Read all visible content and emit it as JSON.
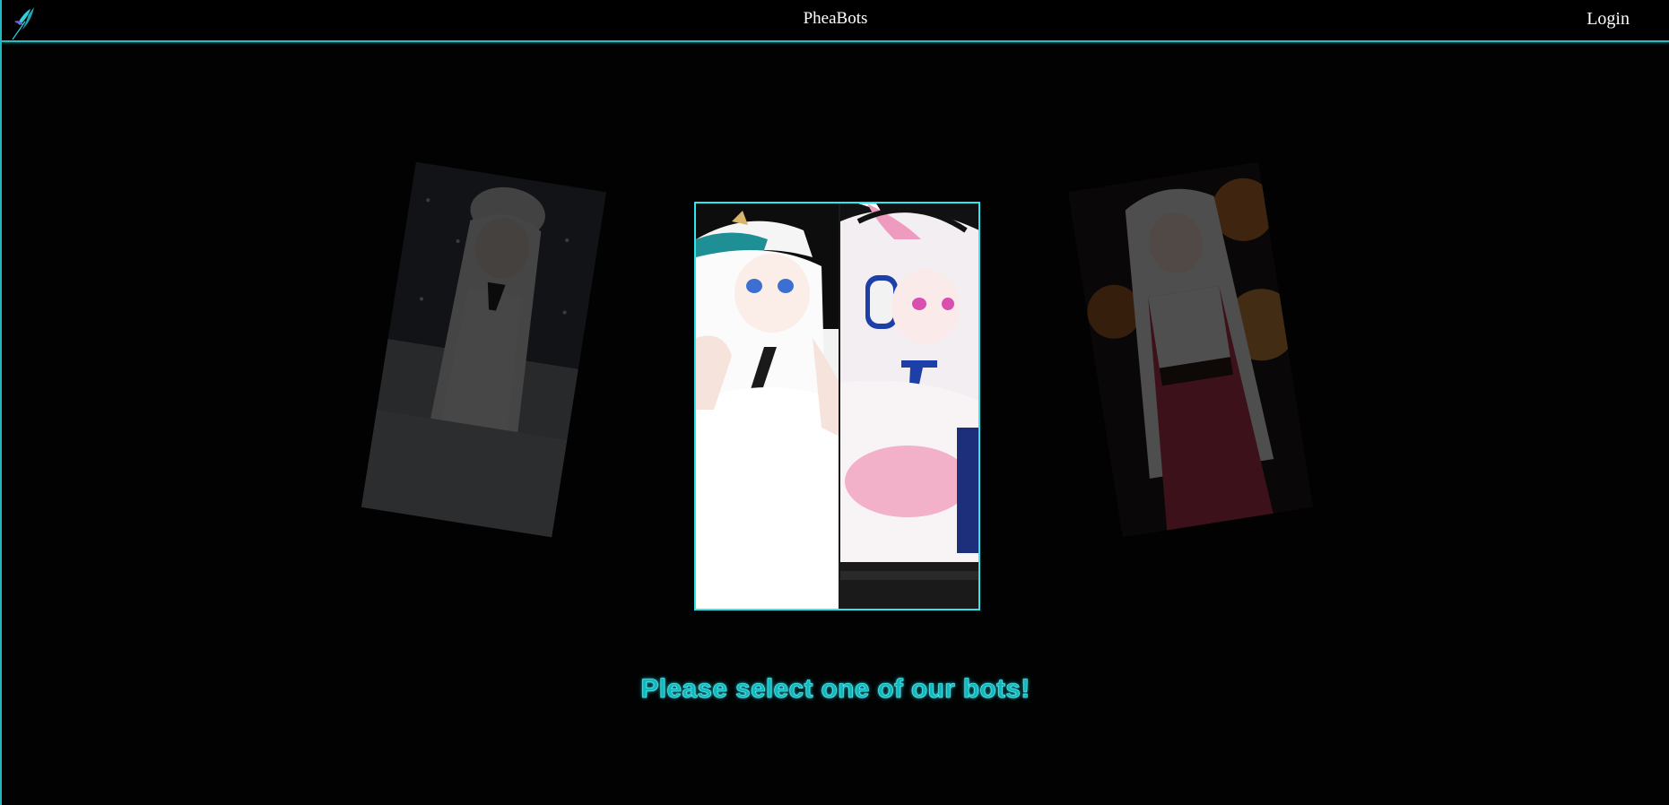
{
  "header": {
    "brand": "PheaBots",
    "login_label": "Login",
    "logo_icon": "feather-logo-icon"
  },
  "bots": [
    {
      "position": "left",
      "description": "white cap girl, faded"
    },
    {
      "position": "center",
      "description": "two bots panel"
    },
    {
      "position": "right",
      "description": "red dress girl, faded"
    }
  ],
  "prompt": "Please select one of our bots!",
  "colors": {
    "accent": "#2ee6ec",
    "prompt_text": "#13b8bd",
    "background": "#000000",
    "header_text": "#ffffff"
  }
}
